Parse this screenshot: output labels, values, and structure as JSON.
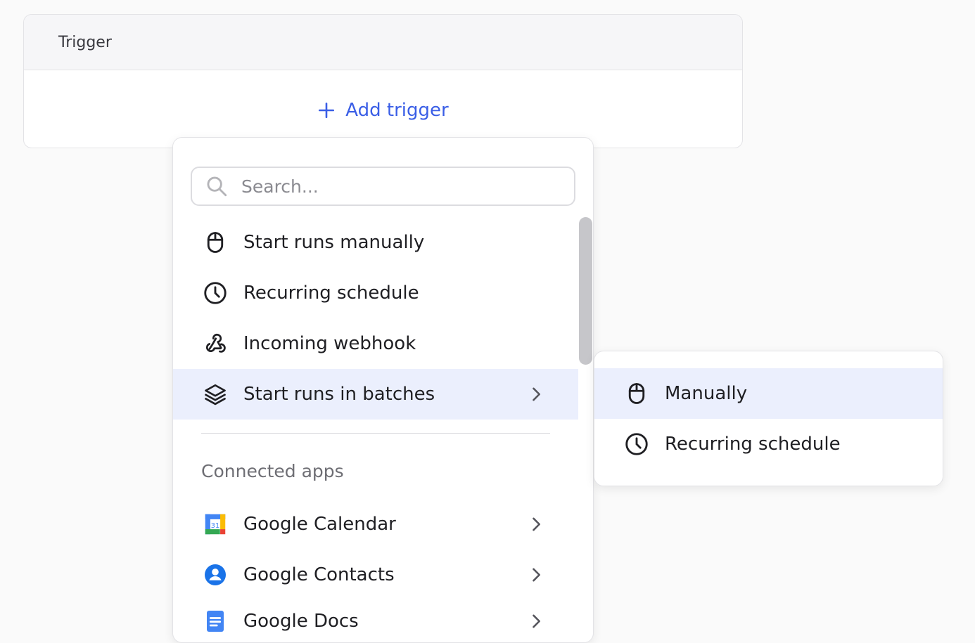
{
  "trigger_card": {
    "header_title": "Trigger",
    "add_label": "Add trigger"
  },
  "menu": {
    "search_placeholder": "Search...",
    "search_value": "",
    "items": [
      {
        "label": "Start runs manually",
        "icon": "mouse-icon"
      },
      {
        "label": "Recurring schedule",
        "icon": "clock-icon"
      },
      {
        "label": "Incoming webhook",
        "icon": "webhook-icon"
      },
      {
        "label": "Start runs in batches",
        "icon": "layers-icon",
        "has_submenu": true,
        "active": true
      }
    ],
    "section_label": "Connected apps",
    "apps": [
      {
        "label": "Google Calendar",
        "icon": "google-calendar-icon",
        "icon_text": "31"
      },
      {
        "label": "Google Contacts",
        "icon": "google-contacts-icon"
      },
      {
        "label": "Google Docs",
        "icon": "google-docs-icon"
      }
    ]
  },
  "submenu": {
    "items": [
      {
        "label": "Manually",
        "icon": "mouse-icon",
        "active": true
      },
      {
        "label": "Recurring schedule",
        "icon": "clock-icon"
      }
    ]
  },
  "colors": {
    "accent": "#3a5ee6",
    "active_bg": "#ebeffd",
    "page_bg": "#fafafa"
  }
}
